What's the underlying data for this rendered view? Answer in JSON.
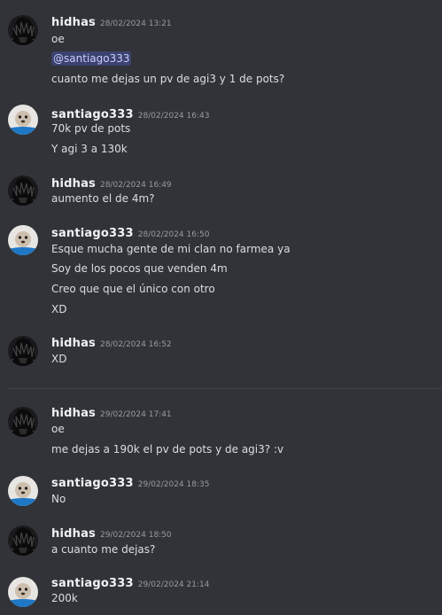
{
  "users": {
    "hidhas": "hidhas",
    "santiago": "santiago333"
  },
  "messages": [
    {
      "username": "hidhas",
      "timestamp": "28/02/2024 13:21",
      "lines": [
        "oe",
        "@santiago333",
        "cuanto me dejas un pv de agi3 y 1 de pots?"
      ]
    },
    {
      "username": "santiago333",
      "timestamp": "28/02/2024 16:43",
      "lines": [
        "70k pv de pots",
        "Y agi 3 a 130k"
      ]
    },
    {
      "username": "hidhas",
      "timestamp": "28/02/2024 16:49",
      "lines": [
        "aumento el de 4m?"
      ]
    },
    {
      "username": "santiago333",
      "timestamp": "28/02/2024 16:50",
      "lines": [
        "Esque mucha gente de mi clan no farmea ya",
        "Soy de los pocos que venden 4m",
        "Creo que que el único con otro",
        "XD"
      ]
    },
    {
      "username": "hidhas",
      "timestamp": "28/02/2024 16:52",
      "lines": [
        "XD"
      ]
    },
    {
      "username": "hidhas",
      "timestamp": "29/02/2024 17:41",
      "lines": [
        "oe",
        "me dejas a 190k el pv de pots y de agi3? :v"
      ]
    },
    {
      "username": "santiago333",
      "timestamp": "29/02/2024 18:35",
      "lines": [
        "No"
      ]
    },
    {
      "username": "hidhas",
      "timestamp": "29/02/2024 18:50",
      "lines": [
        "a cuanto me dejas?"
      ]
    },
    {
      "username": "santiago333",
      "timestamp": "29/02/2024 21:14",
      "lines": [
        "200k"
      ]
    }
  ],
  "icons": {
    "hidhas_avatar": "dark-anime-avatar-icon",
    "santiago_avatar": "seal-avatar-icon"
  },
  "colors": {
    "background": "#313338",
    "username": "#f2f3f5",
    "timestamp": "#949ba4",
    "text": "#dbdee1",
    "mention_bg": "#3c4270",
    "mention_fg": "#c9cdfb"
  }
}
